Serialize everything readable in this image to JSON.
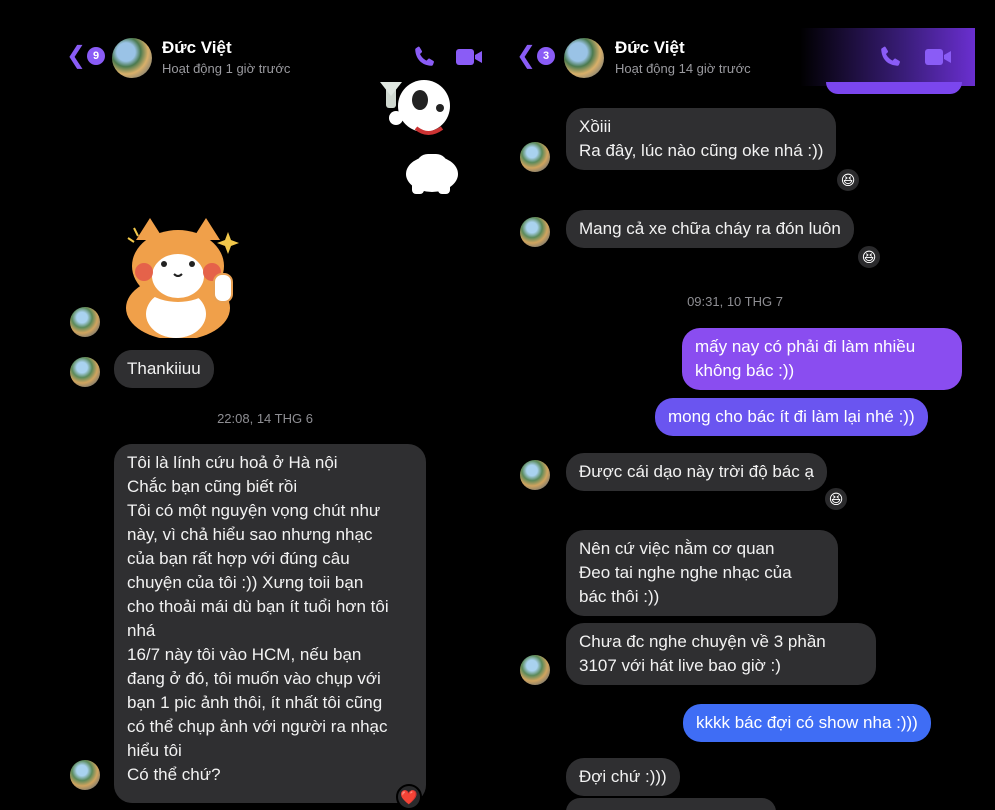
{
  "left": {
    "header": {
      "back_count": "9",
      "name": "Đức Việt",
      "status": "Hoạt động 1 giờ trước"
    },
    "messages": {
      "thanks": "Thankiiuu",
      "timestamp": "22:08, 14 THG 6",
      "long": "Tôi là lính cứu hoả ở Hà nội\nChắc bạn cũng biết rồi\nTôi có một nguyện vọng chút như\nnày, vì chả hiểu sao nhưng nhạc\ncủa bạn rất hợp với đúng câu\nchuyện của tôi :)) Xưng toii bạn\ncho thoải mái dù bạn ít tuổi hơn tôi\nnhá\n16/7 này tôi vào HCM, nếu bạn\nđang ở đó, tôi muốn vào chụp với\nbạn 1 pic ảnh thôi, ít nhất tôi cũng\ncó thể chụp ảnh với người ra nhạc\nhiểu tôi\nCó thể chứ?",
      "long_reaction": "❤️"
    }
  },
  "right": {
    "header": {
      "back_count": "3",
      "name": "Đức Việt",
      "status": "Hoạt động 14 giờ trước"
    },
    "messages": {
      "m1": "Xồiii\nRa đây, lúc nào cũng oke nhá :))",
      "m2": "Mang cả xe chữa cháy ra đón luôn",
      "timestamp": "09:31, 10 THG 7",
      "o1": "mấy nay có phải đi làm nhiều\nkhông bác :))",
      "o2": "mong cho bác ít đi làm lại nhé :))",
      "m3": "Được cái dạo này trời độ bác ạ",
      "m4": "Nên cứ việc nằm cơ quan\nĐeo tai nghe nghe nhạc của\nbác thôi :))",
      "m5": "Chưa đc nghe chuyện về 3 phần\n3107 với hát live bao giờ :)",
      "o3": "kkkk bác đợi có show nha :)))",
      "m6": "Đợi chứ :)))",
      "reaction": "😆"
    }
  },
  "colors": {
    "accent": "#8a5cf6",
    "outgoing_top": "#8a4df0",
    "outgoing_bottom": "#3f6df5",
    "incoming": "#2f2f31"
  }
}
